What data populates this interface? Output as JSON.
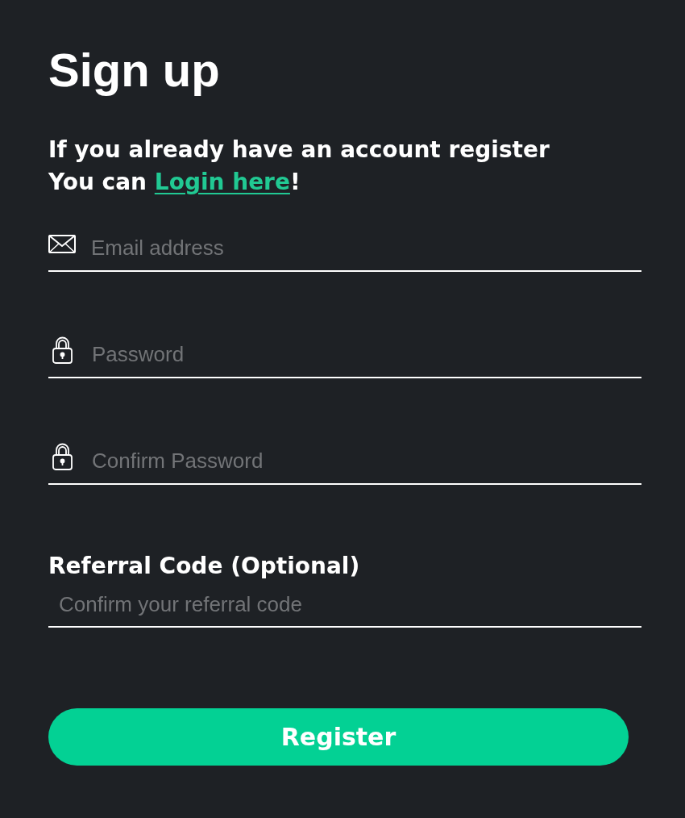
{
  "heading": "Sign up",
  "intro": {
    "line_1": "If you already have an account register",
    "line_2_prefix": "You can ",
    "link": "Login here",
    "line_2_suffix": "!"
  },
  "fields": [
    {
      "kind": "email",
      "placeholder": "Email address"
    },
    {
      "kind": "password",
      "placeholder": "Password"
    },
    {
      "kind": "password",
      "placeholder": "Confirm Password"
    }
  ],
  "referral": {
    "label": "Referral Code (Optional)",
    "placeholder": "Confirm your referral code"
  },
  "submit": "Register"
}
